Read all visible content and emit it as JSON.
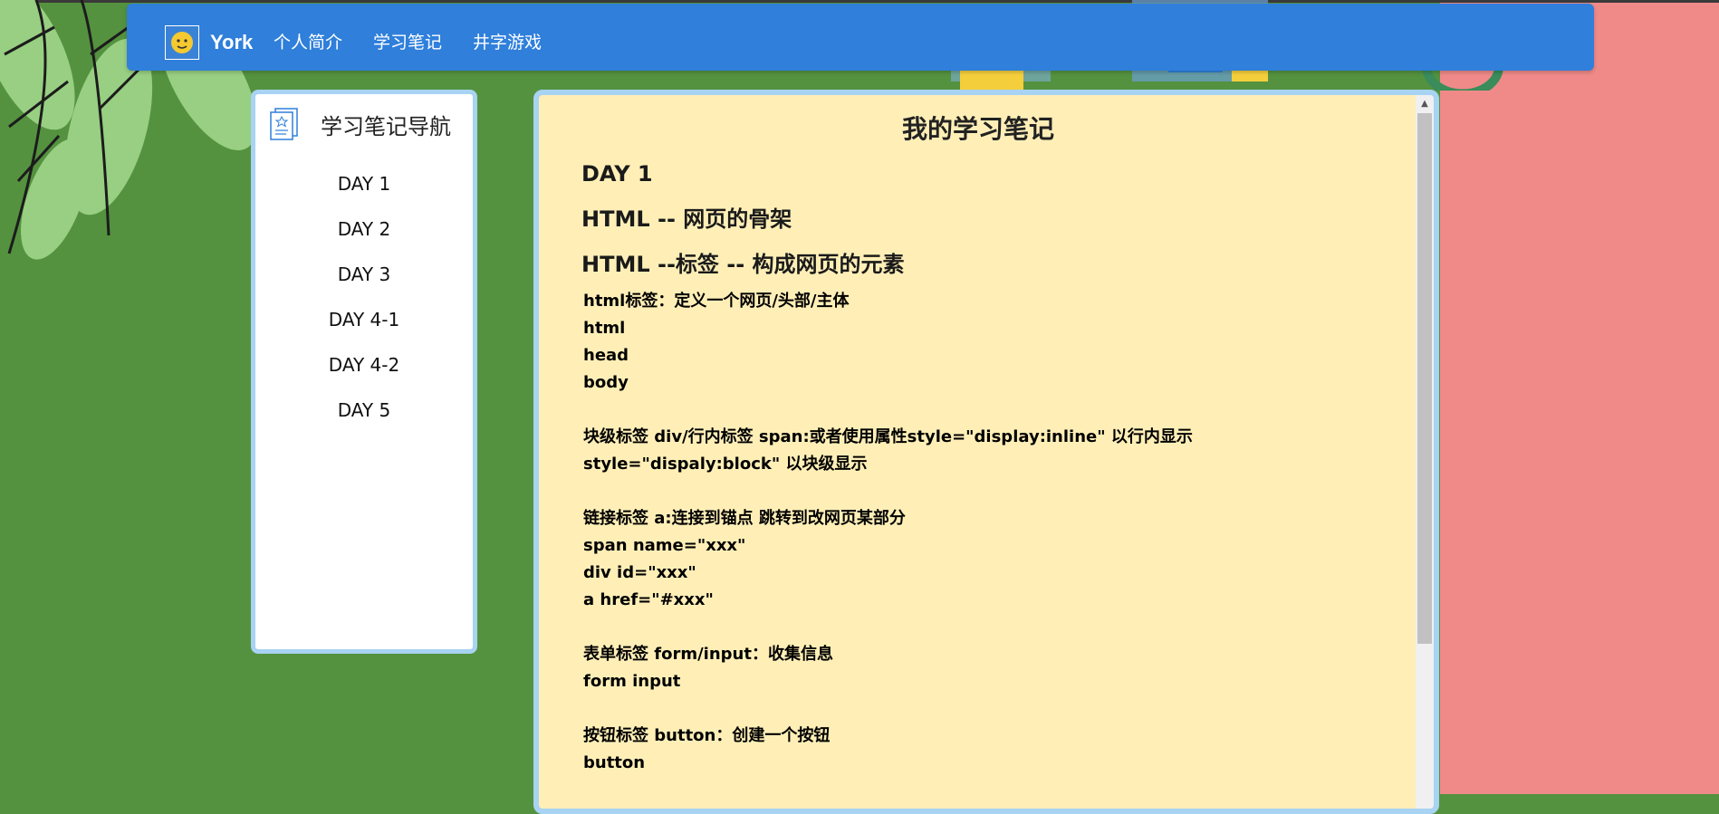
{
  "navbar": {
    "brand": "York",
    "links": [
      "个人简介",
      "学习笔记",
      "井字游戏"
    ]
  },
  "sidebar": {
    "title": "学习笔记导航",
    "items": [
      "DAY 1",
      "DAY 2",
      "DAY 3",
      "DAY 4-1",
      "DAY 4-2",
      "DAY 5"
    ]
  },
  "notes": {
    "title": "我的学习笔记",
    "headings": [
      "DAY 1",
      "HTML -- 网页的骨架",
      "HTML --标签 -- 构成网页的元素"
    ],
    "sections": [
      [
        "html标签：定义一个网页/头部/主体",
        "html",
        "head",
        "body"
      ],
      [
        "块级标签 div/行内标签 span:或者使用属性style=\"display:inline\" 以行内显示",
        "style=\"dispaly:block\" 以块级显示"
      ],
      [
        "链接标签 a:连接到锚点 跳转到改网页某部分",
        "span name=\"xxx\"",
        "div id=\"xxx\"",
        "a href=\"#xxx\""
      ],
      [
        "表单标签 form/input：收集信息",
        "form input"
      ],
      [
        "按钮标签 button：创建一个按钮",
        "button"
      ]
    ]
  },
  "colors": {
    "navbar": "#2f7fdb",
    "background_green": "#54923f",
    "background_pink": "#ef8a88",
    "panel_yellow": "#ffefb7",
    "panel_border": "#a8d3f2"
  },
  "icons": [
    "leaves-decoration",
    "puzzle-decoration",
    "avatar-icon",
    "notes-icon",
    "scroll-up-icon"
  ]
}
